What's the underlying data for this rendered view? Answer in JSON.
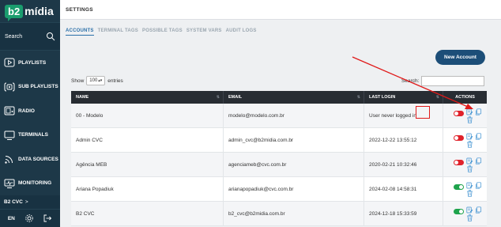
{
  "brand": {
    "mark": "b2",
    "name": "mídia"
  },
  "sidebar": {
    "search_label": "Search",
    "items": [
      {
        "label": "PLAYLISTS",
        "icon": "play-icon"
      },
      {
        "label": "SUB PLAYLISTS",
        "icon": "sub-playlist-icon"
      },
      {
        "label": "RADIO",
        "icon": "radio-icon"
      },
      {
        "label": "TERMINALS",
        "icon": "monitor-icon"
      },
      {
        "label": "DATA SOURCES",
        "icon": "signal-icon"
      },
      {
        "label": "MONITORING",
        "icon": "monitoring-icon"
      }
    ],
    "client": "B2 CVC",
    "client_chevron": ">",
    "language": "EN"
  },
  "header": {
    "title": "SETTINGS"
  },
  "tabs": [
    "ACCOUNTS",
    "TERMINAL TAGS",
    "POSSIBLE TAGS",
    "SYSTEM VARS",
    "AUDIT LOGS"
  ],
  "new_account_label": "New Account",
  "table_controls": {
    "show_label": "Show",
    "page_size": "100",
    "entries_label": "entries",
    "search_label": "Search:"
  },
  "table": {
    "columns": [
      "NAME",
      "EMAIL",
      "LAST LOGIN",
      "ACTIONS"
    ],
    "rows": [
      {
        "name": "00 - Modelo",
        "email": "modelo@modelo.com.br",
        "last_login": "User never logged in",
        "enabled": false
      },
      {
        "name": "Admin CVC",
        "email": "admin_cvc@b2midia.com.br",
        "last_login": "2022-12-22 13:55:12",
        "enabled": false
      },
      {
        "name": "Agência MEB",
        "email": "agenciameb@cvc.com.br",
        "last_login": "2020-02-21 10:32:46",
        "enabled": false
      },
      {
        "name": "Ariana Popadiuk",
        "email": "arianapopadiuk@cvc.com.br",
        "last_login": "2024-02-08 14:58:31",
        "enabled": true
      },
      {
        "name": "B2 CVC",
        "email": "b2_cvc@b2midia.com.br",
        "last_login": "2024-12-18 15:33:59",
        "enabled": true
      }
    ]
  },
  "colors": {
    "sidebar": "#1d3848",
    "primary": "#1c4e78",
    "toggle_off": "#e0222b",
    "toggle_on": "#1ea34c",
    "annotation": "#e01a1a"
  }
}
